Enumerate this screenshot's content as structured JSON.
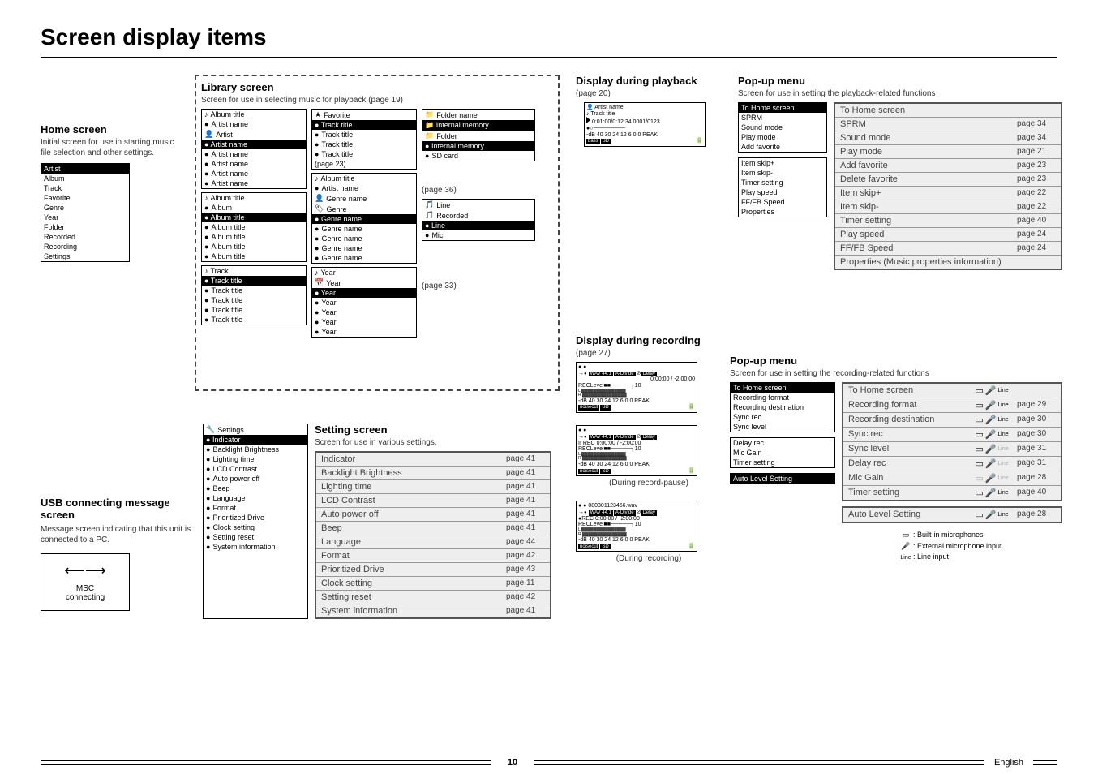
{
  "page_title": "Screen display items",
  "page_number": "10",
  "language_indicator": "English",
  "home_screen": {
    "title": "Home screen",
    "desc": "Initial screen for use in starting music file selection and other settings.",
    "menu": [
      "Artist",
      "Album",
      "Track",
      "Favorite",
      "Genre",
      "Year",
      "Folder",
      "Recorded",
      "Recording",
      "Settings"
    ]
  },
  "usb_screen": {
    "title": "USB connecting message screen",
    "desc": "Message screen indicating that this unit is connected to a PC.",
    "box_line1": "MSC",
    "box_line2": "connecting"
  },
  "library_screen": {
    "title": "Library screen",
    "desc": "Screen for use in selecting music for playback (page 19)",
    "col1_top": {
      "header": "Album title",
      "sub": "Artist name",
      "group": "Artist",
      "items": [
        "Artist name",
        "Artist name",
        "Artist name",
        "Artist name",
        "Artist name"
      ]
    },
    "col1_mid": {
      "header": "Album title",
      "sub": "Album",
      "items": [
        "Album title",
        "Album title",
        "Album title",
        "Album title",
        "Album title"
      ]
    },
    "col1_bot": {
      "header": "Track",
      "items": [
        "Track title",
        "Track title",
        "Track title",
        "Track title",
        "Track title"
      ]
    },
    "col2_top": {
      "header": "Favorite",
      "items": [
        "Track title",
        "Track title",
        "Track title",
        "Track title"
      ],
      "note": "(page 23)"
    },
    "col2_mid": {
      "header": "Album title",
      "sub": "Artist name",
      "sub2": "Genre name",
      "group": "Genre",
      "items": [
        "Genre name",
        "Genre name",
        "Genre name",
        "Genre name",
        "Genre name"
      ]
    },
    "col2_bot": {
      "header": "Year",
      "group": "Year",
      "items": [
        "Year",
        "Year",
        "Year",
        "Year",
        "Year"
      ]
    },
    "col3_top": {
      "items": [
        "Folder name",
        "Internal memory",
        "Folder",
        "Internal memory",
        "SD card"
      ]
    },
    "col3_mid": {
      "note": "(page 36)",
      "items": [
        "Line",
        "Recorded",
        "Line",
        "Mic"
      ]
    },
    "col3_bot": {
      "note": "(page 33)"
    }
  },
  "setting_screen": {
    "title": "Setting screen",
    "desc": "Screen for use in various settings.",
    "side_menu": {
      "header": "Settings",
      "items": [
        "Indicator",
        "Backlight Brightness",
        "Lighting time",
        "LCD Contrast",
        "Auto power off",
        "Beep",
        "Language",
        "Format",
        "Prioritized Drive",
        "Clock setting",
        "Setting reset",
        "System information"
      ]
    },
    "rows": [
      {
        "l": "Indicator",
        "r": "page 41"
      },
      {
        "l": "Backlight Brightness",
        "r": "page 41"
      },
      {
        "l": "Lighting time",
        "r": "page 41"
      },
      {
        "l": "LCD Contrast",
        "r": "page 41"
      },
      {
        "l": "Auto power off",
        "r": "page 41"
      },
      {
        "l": "Beep",
        "r": "page 41"
      },
      {
        "l": "Language",
        "r": "page 44"
      },
      {
        "l": "Format",
        "r": "page 42"
      },
      {
        "l": "Prioritized Drive",
        "r": "page 43"
      },
      {
        "l": "Clock setting",
        "r": "page 11"
      },
      {
        "l": "Setting reset",
        "r": "page 42"
      },
      {
        "l": "System information",
        "r": "page 41"
      }
    ]
  },
  "playback": {
    "title": "Display during playback",
    "note": "(page 20)",
    "lcd": {
      "l1": "Artist name",
      "l2": "Track title",
      "l3": "0:01:00/0:12:34 0001/0123",
      "l4": "-dB 40 30 24    12  6 0 0 PEAK",
      "badges": [
        "bass",
        "SD"
      ]
    }
  },
  "playback_popup": {
    "title": "Pop-up menu",
    "desc": "Screen for use in setting the playback-related functions",
    "small1": [
      "To Home screen",
      "SPRM",
      "Sound mode",
      "Play mode",
      "Add favorite"
    ],
    "small2": [
      "Item skip+",
      "Item skip-",
      "Timer setting",
      "Play speed",
      "FF/FB Speed",
      "Properties"
    ],
    "rows": [
      {
        "l": "To Home screen",
        "r": ""
      },
      {
        "l": "SPRM",
        "r": "page 34"
      },
      {
        "l": "Sound mode",
        "r": "page 34"
      },
      {
        "l": "Play mode",
        "r": "page 21"
      },
      {
        "l": "Add favorite",
        "r": "page 23"
      },
      {
        "l": "Delete favorite",
        "r": "page 23"
      },
      {
        "l": "Item skip+",
        "r": "page 22"
      },
      {
        "l": "Item skip-",
        "r": "page 22"
      },
      {
        "l": "Timer setting",
        "r": "page 40"
      },
      {
        "l": "Play speed",
        "r": "page 24"
      },
      {
        "l": "FF/FB Speed",
        "r": "page 24"
      },
      {
        "l": "Properties (Music properties information)",
        "r": ""
      }
    ]
  },
  "recording": {
    "title": "Display during recording",
    "note": "(page 27)",
    "lcd1": {
      "badges_top": [
        "WAV 44.1",
        "A-Divide",
        "Delay"
      ],
      "time": "0:00:00 / -2:00:00",
      "rec_level": "RECLevel",
      "meter": "-dB 40 30 24    12  6 0 0 PEAK",
      "badges_bot": [
        "noisecut",
        "SD"
      ]
    },
    "lcd2_caption": "(During record-pause)",
    "lcd2_prefix": "II REC",
    "lcd3": {
      "filename": "080301123456.wav",
      "prefix": "●REC",
      "time": "0:00:00 / -2:00:00"
    },
    "lcd3_caption": "(During recording)"
  },
  "recording_popup": {
    "title": "Pop-up menu",
    "desc": "Screen for use in setting the recording-related functions",
    "small1": [
      "To Home screen",
      "Recording format",
      "Recording destination",
      "Sync rec",
      "Sync level"
    ],
    "small2": [
      "Delay rec",
      "Mic Gain",
      "Timer setting"
    ],
    "small3": [
      "Auto Level Setting"
    ],
    "rows": [
      {
        "l": "To Home screen",
        "r": ""
      },
      {
        "l": "Recording format",
        "r": "page 29"
      },
      {
        "l": "Recording destination",
        "r": "page 30"
      },
      {
        "l": "Sync rec",
        "r": "page 30"
      },
      {
        "l": "Sync level",
        "r": "page 31"
      },
      {
        "l": "Delay rec",
        "r": "page 31"
      },
      {
        "l": "Mic Gain",
        "r": "page 28"
      },
      {
        "l": "Timer setting",
        "r": "page 40"
      }
    ],
    "rows2": [
      {
        "l": "Auto Level Setting",
        "r": "page 28"
      }
    ],
    "legend": [
      {
        "sym": "▭",
        "txt": ": Built-in microphones"
      },
      {
        "sym": "🎤",
        "txt": ": External microphone input"
      },
      {
        "sym": "Line",
        "txt": ": Line input"
      }
    ]
  }
}
